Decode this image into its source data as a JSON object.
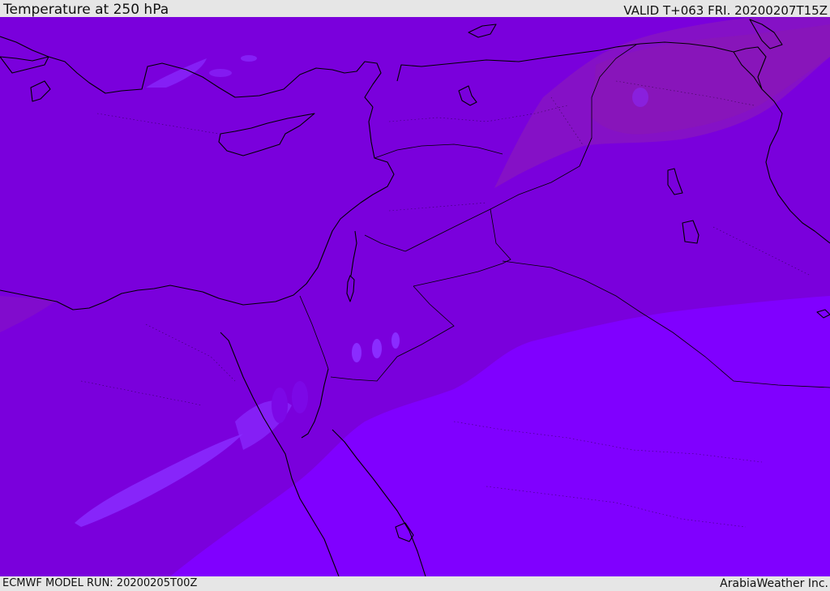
{
  "header": {
    "title": "Temperature at 250 hPa",
    "valid_time": "VALID T+063 FRI. 20200207T15Z"
  },
  "footer": {
    "model_run": "ECMWF MODEL RUN: 20200205T00Z",
    "credit": "ArabiaWeather Inc."
  },
  "map": {
    "colors": {
      "warm_band": "#8b1ab0",
      "mid_band": "#7a00dc",
      "cool_band": "#8000ff",
      "light_streak": "#8a2cff",
      "coastline": "#000000"
    }
  }
}
